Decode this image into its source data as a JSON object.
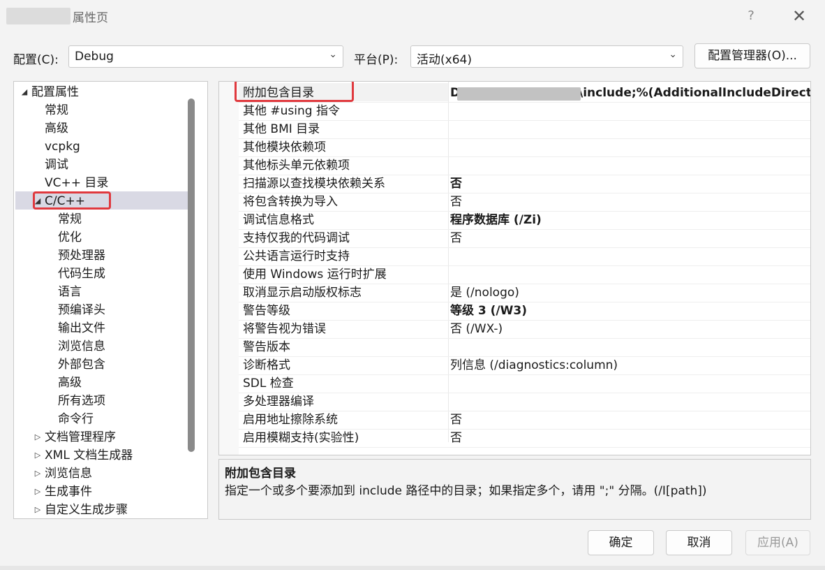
{
  "window": {
    "title": "属性页",
    "help_glyph": "?",
    "close_glyph": "✕"
  },
  "config": {
    "label": "配置(C):",
    "value": "Debug",
    "platform_label": "平台(P):",
    "platform_value": "活动(x64)",
    "manager_button": "配置管理器(O)..."
  },
  "tree": {
    "items": [
      {
        "label": "配置属性",
        "arrow": "◢"
      },
      {
        "label": "常规"
      },
      {
        "label": "高级"
      },
      {
        "label": "vcpkg"
      },
      {
        "label": "调试"
      },
      {
        "label": "VC++ 目录"
      },
      {
        "label": "C/C++",
        "arrow": "◢"
      },
      {
        "label": "常规"
      },
      {
        "label": "优化"
      },
      {
        "label": "预处理器"
      },
      {
        "label": "代码生成"
      },
      {
        "label": "语言"
      },
      {
        "label": "预编译头"
      },
      {
        "label": "输出文件"
      },
      {
        "label": "浏览信息"
      },
      {
        "label": "外部包含"
      },
      {
        "label": "高级"
      },
      {
        "label": "所有选项"
      },
      {
        "label": "命令行"
      },
      {
        "label": "文档管理程序",
        "arrow": "▷"
      },
      {
        "label": "XML 文档生成器",
        "arrow": "▷"
      },
      {
        "label": "浏览信息",
        "arrow": "▷"
      },
      {
        "label": "生成事件",
        "arrow": "▷"
      },
      {
        "label": "自定义生成步骤",
        "arrow": "▷"
      }
    ]
  },
  "properties": [
    {
      "name": "附加包含目录",
      "value": "\\include;%(AdditionalIncludeDirector",
      "prefix": "D",
      "bold": true
    },
    {
      "name": "其他 #using 指令",
      "value": ""
    },
    {
      "name": "其他 BMI 目录",
      "value": ""
    },
    {
      "name": "其他模块依赖项",
      "value": ""
    },
    {
      "name": "其他标头单元依赖项",
      "value": ""
    },
    {
      "name": "扫描源以查找模块依赖关系",
      "value": "否",
      "bold": true
    },
    {
      "name": "将包含转换为导入",
      "value": "否"
    },
    {
      "name": "调试信息格式",
      "value": "程序数据库 (/Zi)",
      "bold": true
    },
    {
      "name": "支持仅我的代码调试",
      "value": "否"
    },
    {
      "name": "公共语言运行时支持",
      "value": ""
    },
    {
      "name": "使用 Windows 运行时扩展",
      "value": ""
    },
    {
      "name": "取消显示启动版权标志",
      "value": "是 (/nologo)"
    },
    {
      "name": "警告等级",
      "value": "等级 3 (/W3)",
      "bold": true
    },
    {
      "name": "将警告视为错误",
      "value": "否 (/WX-)"
    },
    {
      "name": "警告版本",
      "value": ""
    },
    {
      "name": "诊断格式",
      "value": "列信息 (/diagnostics:column)"
    },
    {
      "name": "SDL 检查",
      "value": ""
    },
    {
      "name": "多处理器编译",
      "value": ""
    },
    {
      "name": "启用地址擦除系统",
      "value": "否"
    },
    {
      "name": "启用模糊支持(实验性)",
      "value": "否"
    }
  ],
  "description": {
    "title": "附加包含目录",
    "text": "指定一个或多个要添加到 include 路径中的目录；如果指定多个，请用 \";\" 分隔。(/I[path])"
  },
  "buttons": {
    "ok": "确定",
    "cancel": "取消",
    "apply": "应用(A)"
  },
  "colors": {
    "highlight_box": "#e0393e",
    "selection": "#d9d9e4"
  }
}
